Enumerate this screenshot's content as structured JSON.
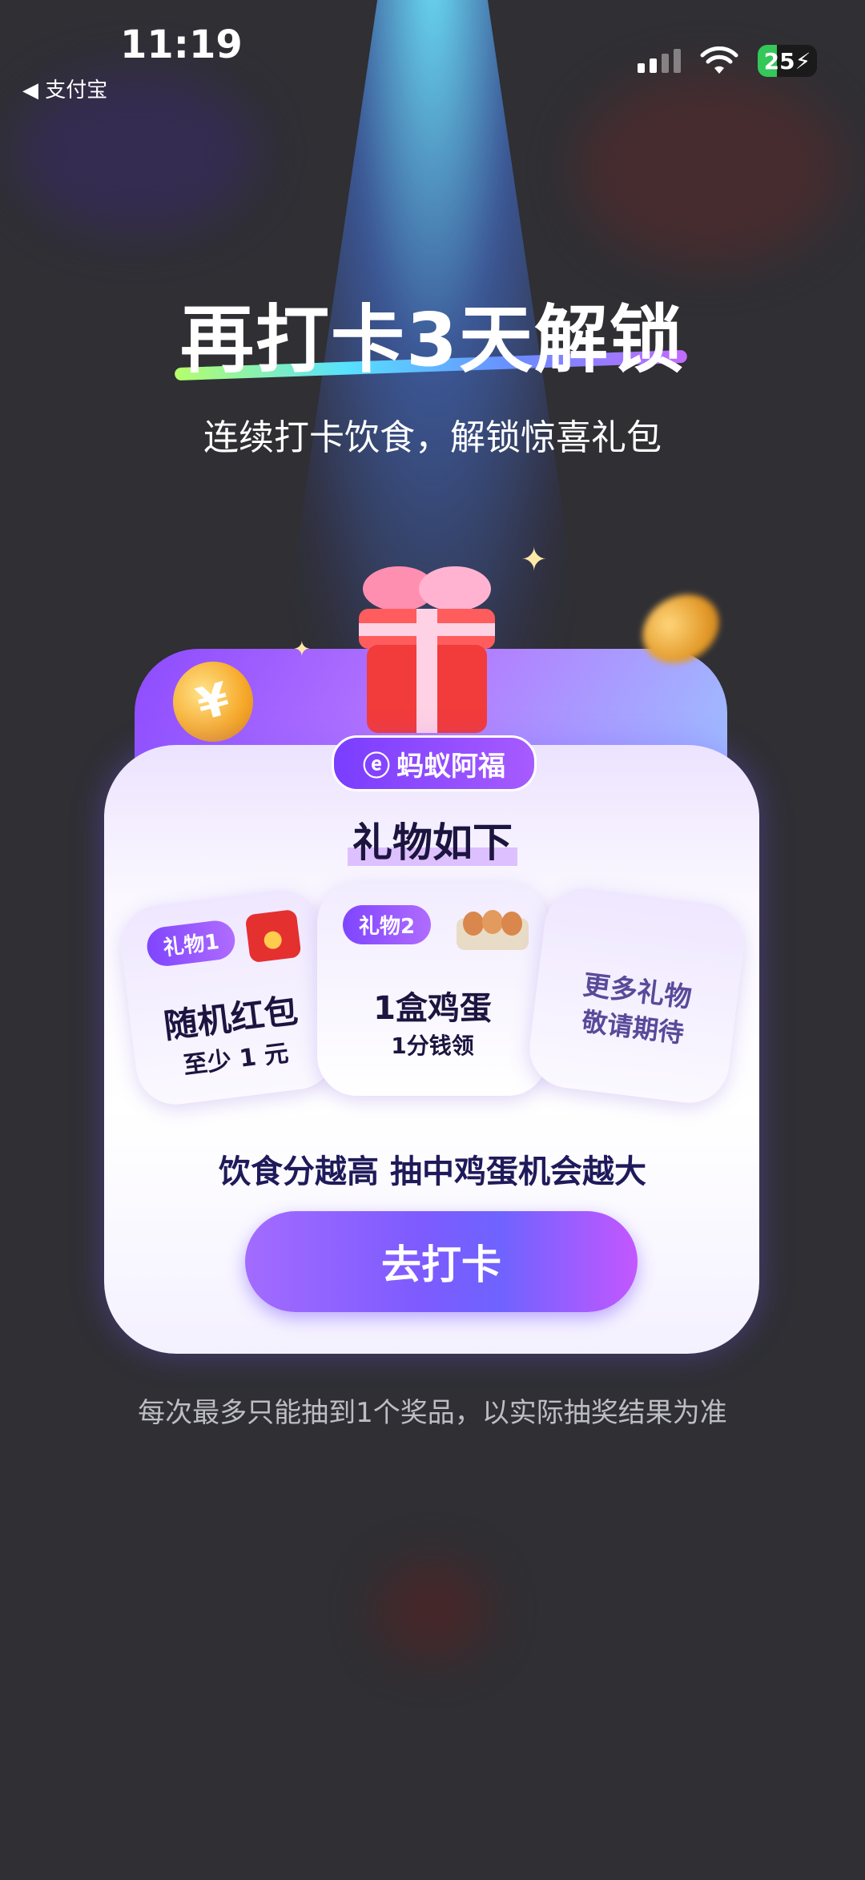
{
  "status_bar": {
    "time": "11:19",
    "back_label": "◀ 支付宝",
    "battery": "25"
  },
  "promo": {
    "headline": "再打卡3天解锁",
    "subtitle": "连续打卡饮食，解锁惊喜礼包",
    "brand": "蚂蚁阿福",
    "gifts_title": "礼物如下",
    "gifts": [
      {
        "tag": "礼物1",
        "title": "随机红包",
        "detail": "至少 1 元"
      },
      {
        "tag": "礼物2",
        "title": "1盒鸡蛋",
        "detail": "1分钱领"
      },
      {
        "tag": "",
        "title": "更多礼物",
        "detail": "敬请期待"
      }
    ],
    "hint": "饮食分越高 抽中鸡蛋机会越大",
    "cta": "去打卡",
    "footnote": "每次最多只能抽到1个奖品，以实际抽奖结果为准"
  },
  "colors": {
    "accent": "#7f45ff",
    "background": "#2f2f34"
  }
}
